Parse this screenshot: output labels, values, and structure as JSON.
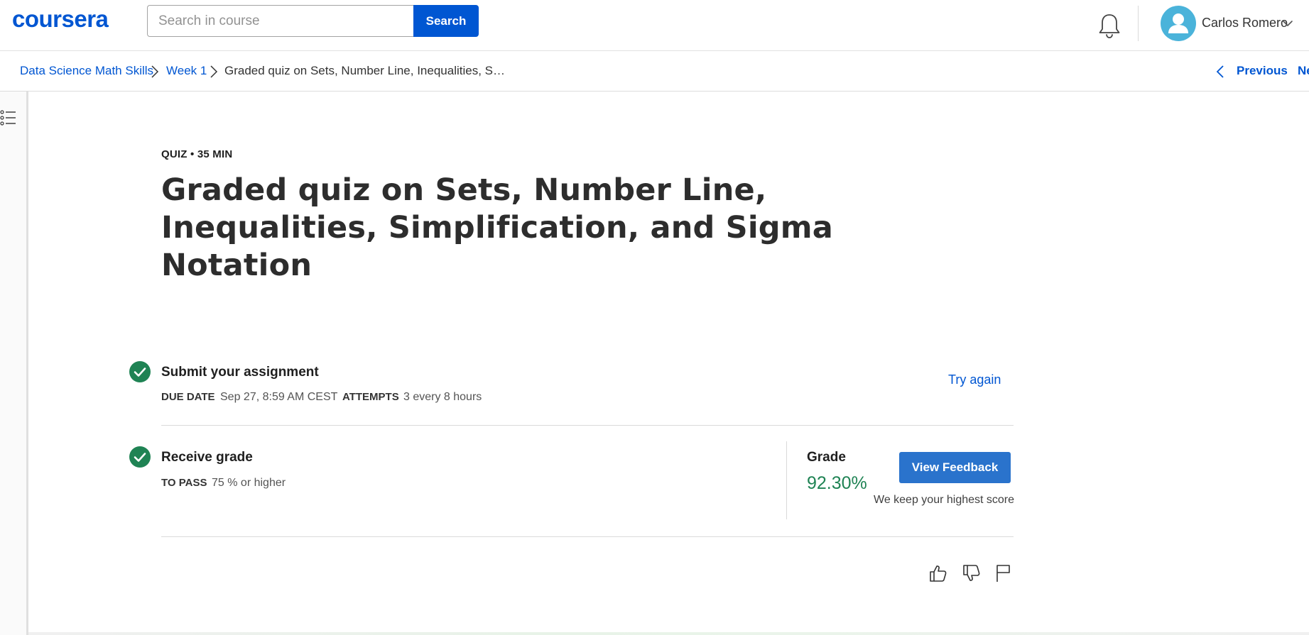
{
  "header": {
    "logo_text": "coursera",
    "search": {
      "placeholder": "Search in course",
      "value": "",
      "button_label": "Search"
    },
    "icons": {
      "notifications": "bell-icon",
      "avatar": "user-avatar-icon",
      "menu": "chevron-down-icon"
    },
    "user_name": "Carlos Romero"
  },
  "breadcrumb": {
    "items": [
      {
        "label": "Data Science Math Skills"
      },
      {
        "label": "Week 1"
      },
      {
        "label": "Graded quiz on Sets, Number Line, Inequalities, S…"
      }
    ],
    "previous_label": "Previous",
    "next_label": "Ne"
  },
  "sidebar": {
    "toggle_icon": "list-outline-icon"
  },
  "main": {
    "kicker": "QUIZ • 35 MIN",
    "title": "Graded quiz on Sets, Number Line, Inequalities, Simplification, and Sigma Notation",
    "submit": {
      "title": "Submit your assignment",
      "due_label": "DUE DATE",
      "due_value": "Sep 27, 8:59 AM CEST",
      "attempts_label": "ATTEMPTS",
      "attempts_value": "3 every 8 hours",
      "action_label": "Try again"
    },
    "receive": {
      "title": "Receive grade",
      "pass_label": "TO PASS",
      "pass_value": "75 % or higher",
      "grade_label": "Grade",
      "grade_value": "92.30%",
      "feedback_button": "View Feedback",
      "note": "We keep your highest score"
    },
    "feedback_icons": [
      "thumbs-up-icon",
      "thumbs-down-icon",
      "flag-icon"
    ]
  },
  "colors": {
    "brand": "#0056d2",
    "success": "#1f8354",
    "button": "#2a73cc",
    "avatar": "#4ab3da",
    "text": "#1f1f1f"
  }
}
